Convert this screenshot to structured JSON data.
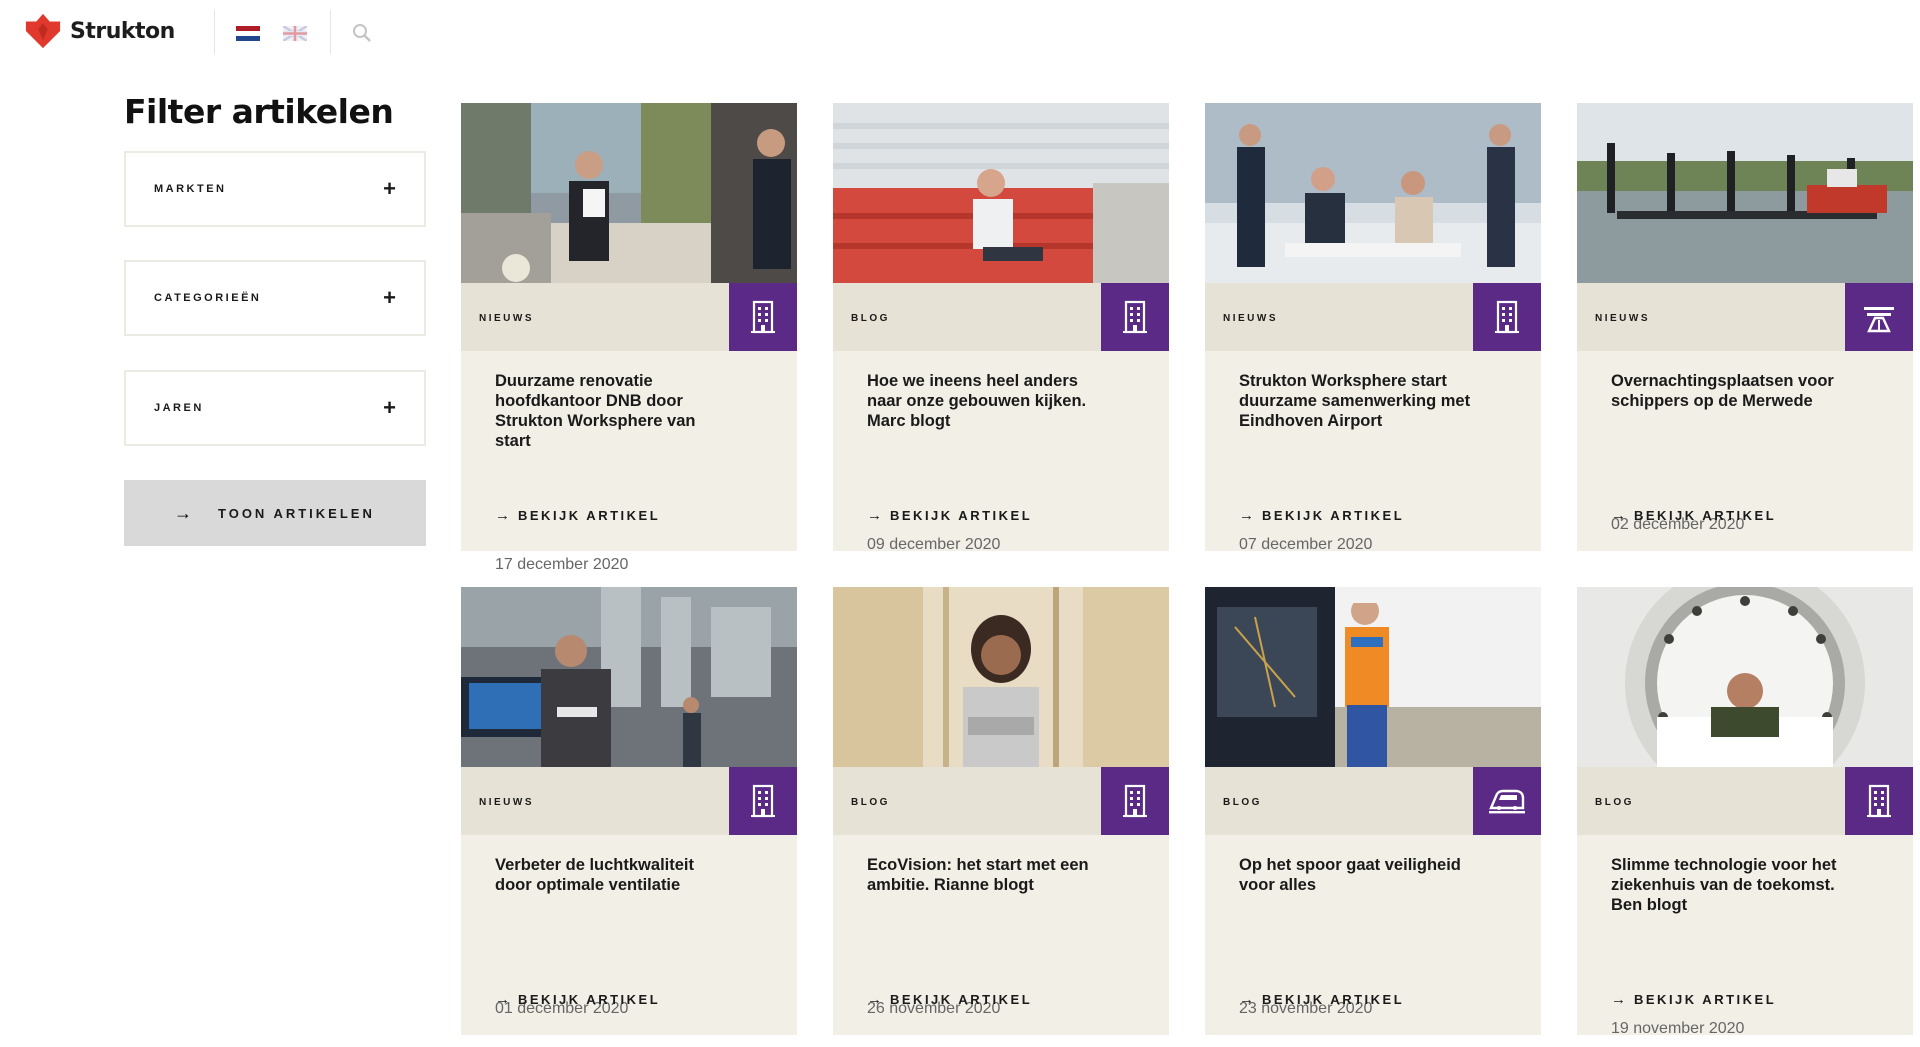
{
  "header": {
    "brand": "Strukton",
    "logo_icon": "strukton-logo-icon",
    "lang_nl_icon": "flag-nl-icon",
    "lang_en_icon": "flag-uk-icon",
    "search_icon": "search-icon"
  },
  "sidebar": {
    "title": "Filter artikelen",
    "filters": [
      {
        "label": "MARKTEN",
        "toggle": "+"
      },
      {
        "label": "CATEGORIEËN",
        "toggle": "+"
      },
      {
        "label": "JAREN",
        "toggle": "+"
      }
    ],
    "show_button": {
      "arrow": "→",
      "label": "TOON ARTIKELEN"
    }
  },
  "colors": {
    "accent": "#5b2a86",
    "card_bg": "#f1efe6",
    "band_bg": "#e6e2d6",
    "brand_red": "#e0382c"
  },
  "cards": [
    {
      "category": "NIEUWS",
      "icon": "building-icon",
      "title": "Duurzame renovatie hoofdkantoor DNB door Strukton Worksphere van start",
      "date": "17 december 2020",
      "link": "BEKIJK ARTIKEL",
      "arrow": "→"
    },
    {
      "category": "BLOG",
      "icon": "building-icon",
      "title": "Hoe we ineens heel anders naar onze gebouwen kijken. Marc blogt",
      "date": "09 december 2020",
      "link": "BEKIJK ARTIKEL",
      "arrow": "→"
    },
    {
      "category": "NIEUWS",
      "icon": "building-icon",
      "title": "Strukton Worksphere start duurzame samenwerking met Eindhoven Airport",
      "date": "07 december 2020",
      "link": "BEKIJK ARTIKEL",
      "arrow": "→"
    },
    {
      "category": "NIEUWS",
      "icon": "road-icon",
      "title": "Overnachtingsplaatsen voor schippers op de Merwede",
      "date": "02 december 2020",
      "link": "BEKIJK ARTIKEL",
      "arrow": "→"
    },
    {
      "category": "NIEUWS",
      "icon": "building-icon",
      "title": "Verbeter de luchtkwaliteit door optimale ventilatie",
      "date": "01 december 2020",
      "link": "BEKIJK ARTIKEL",
      "arrow": "→"
    },
    {
      "category": "BLOG",
      "icon": "building-icon",
      "title": "EcoVision: het start met een ambitie. Rianne blogt",
      "date": "26 november 2020",
      "link": "BEKIJK ARTIKEL",
      "arrow": "→"
    },
    {
      "category": "BLOG",
      "icon": "train-icon",
      "title": "Op het spoor gaat veiligheid voor alles",
      "date": "23 november 2020",
      "link": "BEKIJK ARTIKEL",
      "arrow": "→"
    },
    {
      "category": "BLOG",
      "icon": "building-icon",
      "title": "Slimme technologie voor het ziekenhuis van de toekomst. Ben blogt",
      "date": "19 november 2020",
      "link": "BEKIJK ARTIKEL",
      "arrow": "→"
    }
  ]
}
